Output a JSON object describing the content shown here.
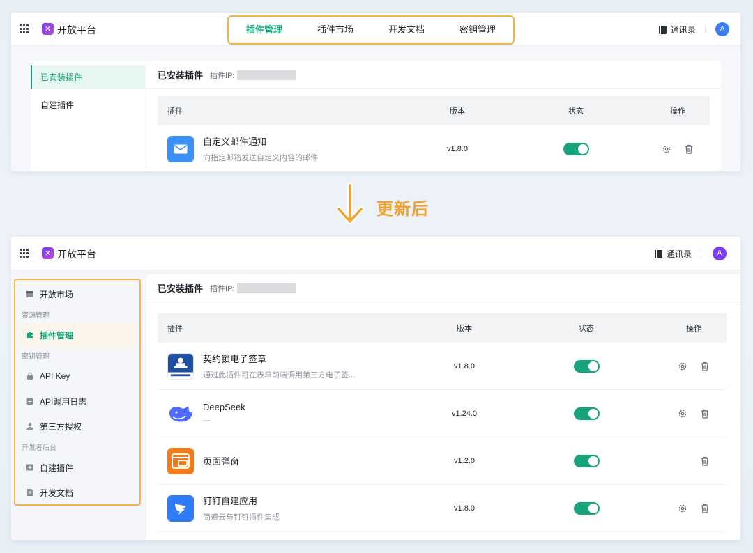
{
  "brand": "开放平台",
  "top_tabs": [
    "插件管理",
    "插件市场",
    "开发文档",
    "密钥管理"
  ],
  "contacts_label": "通讯录",
  "avatar_letter": "A",
  "colors": {
    "accent": "#17a37b",
    "highlight_border": "#f2b24e",
    "arrow": "#f0a32e",
    "avatar_before": "#3a7cf2",
    "avatar_after": "#7b3cf5"
  },
  "before": {
    "sidebar": [
      "已安装插件",
      "自建插件"
    ],
    "section_title": "已安装插件",
    "ip_label": "插件IP:",
    "columns": [
      "插件",
      "版本",
      "状态",
      "操作"
    ],
    "rows": [
      {
        "name": "自定义邮件通知",
        "desc": "向指定邮箱发送自定义内容的邮件",
        "version": "v1.8.0",
        "enabled": true,
        "icon": "mail-icon",
        "ops": [
          "gear-icon",
          "trash-icon"
        ]
      }
    ]
  },
  "update_label": "更新后",
  "after": {
    "sidebar": {
      "top_item": "开放市场",
      "groups": [
        {
          "title": "资源管理",
          "items": [
            "插件管理"
          ]
        },
        {
          "title": "密钥管理",
          "items": [
            "API Key",
            "API调用日志",
            "第三方授权"
          ]
        },
        {
          "title": "开发者后台",
          "items": [
            "自建插件",
            "开发文档"
          ]
        }
      ]
    },
    "section_title": "已安装插件",
    "ip_label": "插件IP:",
    "columns": [
      "插件",
      "版本",
      "状态",
      "操作"
    ],
    "rows": [
      {
        "name": "契约锁电子签章",
        "desc": "通过此插件可在表单前端调用第三方电子签...",
        "version": "v1.8.0",
        "enabled": true,
        "icon": "seal-icon",
        "ops": [
          "gear-icon",
          "trash-icon"
        ]
      },
      {
        "name": "DeepSeek",
        "desc": "—",
        "version": "v1.24.0",
        "enabled": true,
        "icon": "whale-icon",
        "ops": [
          "gear-icon",
          "trash-icon"
        ]
      },
      {
        "name": "页面弹窗",
        "desc": "",
        "version": "v1.2.0",
        "enabled": true,
        "icon": "popup-icon",
        "ops": [
          "trash-icon"
        ]
      },
      {
        "name": "钉钉自建应用",
        "desc": "简道云与钉钉插件集成",
        "version": "v1.8.0",
        "enabled": true,
        "icon": "dingtalk-icon",
        "ops": [
          "gear-icon",
          "trash-icon"
        ]
      }
    ]
  }
}
